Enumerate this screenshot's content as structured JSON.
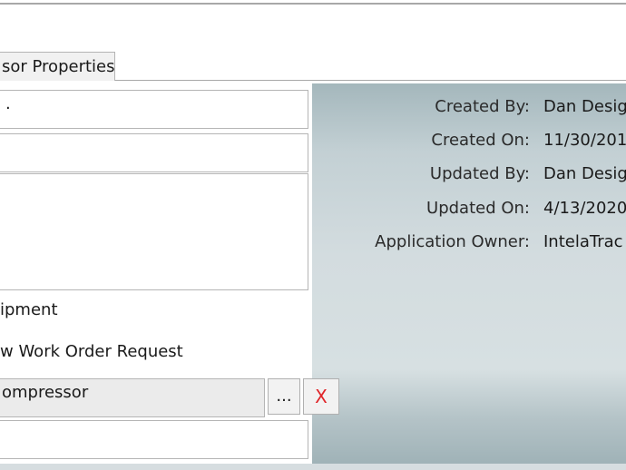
{
  "tab": {
    "label": "sor Properties"
  },
  "fields": {
    "field1_value": ".",
    "field2_value": "",
    "description_value": "",
    "equipment_label": "ipment",
    "work_order_label": "w Work Order Request",
    "lookup_value": "ompressor",
    "browse_label": "...",
    "clear_label": "X",
    "last_value": ""
  },
  "metadata": [
    {
      "label": "Created By:",
      "value": "Dan Desig"
    },
    {
      "label": "Created On:",
      "value": "11/30/201"
    },
    {
      "label": "Updated By:",
      "value": "Dan Desig"
    },
    {
      "label": "Updated On:",
      "value": "4/13/2020"
    },
    {
      "label": "Application Owner:",
      "value": "IntelaTrac"
    }
  ],
  "colors": {
    "clear_button": "#e0262a",
    "panel_gray": "#d3dcdf"
  }
}
